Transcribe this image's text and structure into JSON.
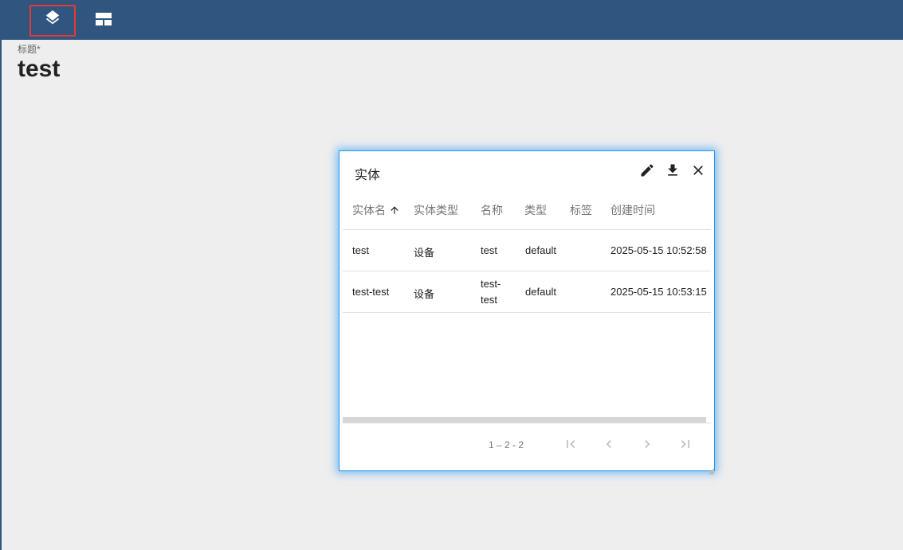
{
  "toolbar": {
    "layers_icon": "layers-icon",
    "layout_icon": "table-layout-icon",
    "highlight_color": "#e53935",
    "background_color": "#305680"
  },
  "title": {
    "label": "标题*",
    "value": "test"
  },
  "dialog": {
    "title": "实体",
    "actions": [
      "edit-icon",
      "download-icon",
      "close-icon"
    ],
    "table": {
      "headers": [
        "实体名",
        "实体类型",
        "名称",
        "类型",
        "标签",
        "创建时间"
      ],
      "sort_icon": "arrow-up-icon",
      "rows": [
        {
          "entity_name": "test",
          "entity_type": "设备",
          "name": "test",
          "name_line2": "",
          "type": "default",
          "label": "",
          "created": "2025-05-15 10:52:58"
        },
        {
          "entity_name": "test-test",
          "entity_type": "设备",
          "name": "test-",
          "name_line2": "test",
          "type": "default",
          "label": "",
          "created": "2025-05-15 10:53:15"
        }
      ]
    },
    "paginator": {
      "range": "1 – 2 - 2"
    },
    "accent_color": "#2196f3"
  }
}
